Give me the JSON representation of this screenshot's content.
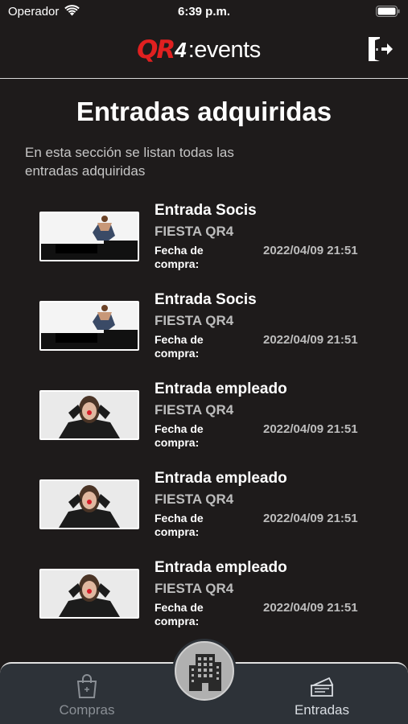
{
  "status_bar": {
    "carrier": "Operador",
    "time": "6:39 p.m."
  },
  "header": {
    "logo_qr": "QR",
    "logo_4": "4",
    "logo_events": ":events",
    "logout_icon": "logout-door-icon"
  },
  "page": {
    "title": "Entradas adquiridas",
    "subtitle": "En esta sección se listan todas las entradas adquiridas"
  },
  "tickets": [
    {
      "name": "Entrada Socis",
      "event": "FIESTA QR4",
      "date_label": "Fecha de compra:",
      "date": "2022/04/09 21:51",
      "image": "seated-person-photo"
    },
    {
      "name": "Entrada Socis",
      "event": "FIESTA QR4",
      "date_label": "Fecha de compra:",
      "date": "2022/04/09 21:51",
      "image": "seated-person-photo"
    },
    {
      "name": "Entrada empleado",
      "event": "FIESTA QR4",
      "date_label": "Fecha de compra:",
      "date": "2022/04/09 21:51",
      "image": "woman-red-nose-photo"
    },
    {
      "name": "Entrada empleado",
      "event": "FIESTA QR4",
      "date_label": "Fecha de compra:",
      "date": "2022/04/09 21:51",
      "image": "woman-red-nose-photo"
    },
    {
      "name": "Entrada empleado",
      "event": "FIESTA QR4",
      "date_label": "Fecha de compra:",
      "date": "2022/04/09 21:51",
      "image": "woman-red-nose-photo"
    }
  ],
  "tab_bar": {
    "compras": {
      "label": "Compras",
      "icon": "shopping-bag-icon"
    },
    "center": {
      "icon": "building-icon"
    },
    "entradas": {
      "label": "Entradas",
      "icon": "tickets-icon"
    }
  },
  "colors": {
    "background": "#1e1b1b",
    "tab_bar": "#2d3238",
    "logo_red": "#e02020"
  }
}
